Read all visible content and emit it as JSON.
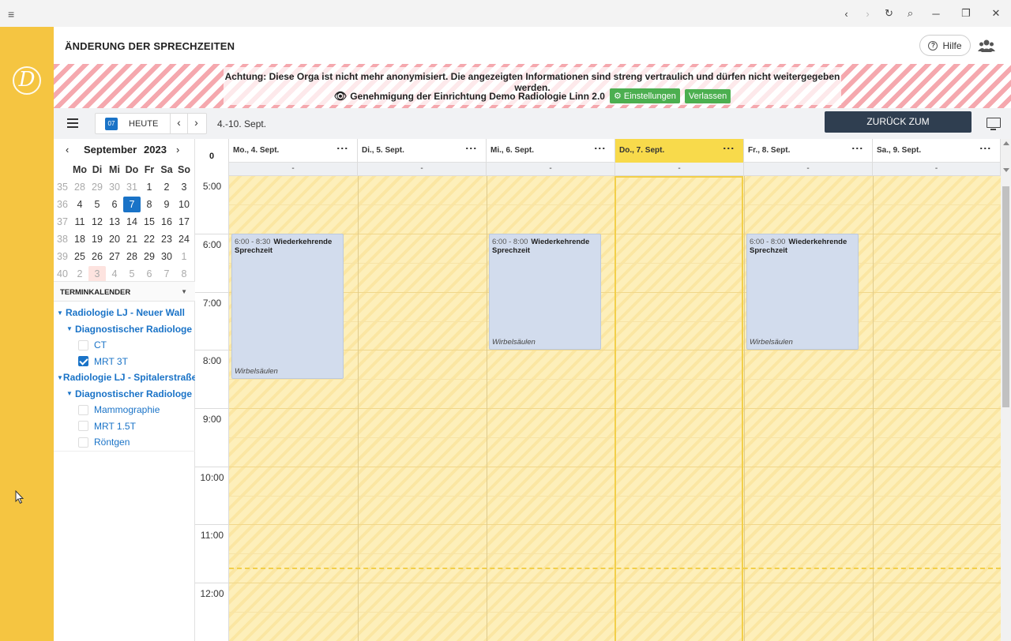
{
  "titlebar": {
    "menu_icon": "≡",
    "back": "‹",
    "forward": "›",
    "reload": "↻",
    "search": "⌕",
    "minimize": "─",
    "restore": "❐",
    "close": "✕"
  },
  "app": {
    "logo": "D"
  },
  "header": {
    "title": "ÄNDERUNG DER SPRECHZEITEN",
    "help_label": "Hilfe",
    "help_icon": "?"
  },
  "banner": {
    "warning": "Achtung: Diese Orga ist nicht mehr anonymisiert. Die angezeigten Informationen sind streng vertraulich und dürfen nicht weitergegeben werden.",
    "eye_icon": "👁",
    "approval": "Genehmigung der Einrichtung Demo Radiologie Linn 2.0",
    "settings_label": "⚙ Einstellungen",
    "leave_label": "Verlassen"
  },
  "toolbar": {
    "calendar_icon_day": "07",
    "today_label": "HEUTE",
    "prev": "‹",
    "next": "›",
    "range": "4.-10. Sept.",
    "back_label": "ZURÜCK ZUM TERMINKALENDER"
  },
  "mini": {
    "prev": "‹",
    "next": "›",
    "month": "September",
    "year": "2023",
    "headers": [
      "Mo",
      "Di",
      "Mi",
      "Do",
      "Fr",
      "Sa",
      "So"
    ],
    "weeks": [
      {
        "wk": "35",
        "days": [
          "28",
          "29",
          "30",
          "31",
          "1",
          "2",
          "3"
        ]
      },
      {
        "wk": "36",
        "days": [
          "4",
          "5",
          "6",
          "7",
          "8",
          "9",
          "10"
        ]
      },
      {
        "wk": "37",
        "days": [
          "11",
          "12",
          "13",
          "14",
          "15",
          "16",
          "17"
        ]
      },
      {
        "wk": "38",
        "days": [
          "18",
          "19",
          "20",
          "21",
          "22",
          "23",
          "24"
        ]
      },
      {
        "wk": "39",
        "days": [
          "25",
          "26",
          "27",
          "28",
          "29",
          "30",
          "1"
        ]
      },
      {
        "wk": "40",
        "days": [
          "2",
          "3",
          "4",
          "5",
          "6",
          "7",
          "8"
        ]
      }
    ]
  },
  "terminkalender": {
    "heading": "TERMINKALENDER",
    "toggle": "▼",
    "l1a": "Radiologie LJ - Neuer Wall",
    "l2a": "Diagnostischer Radiologe",
    "ct": "CT",
    "mrt3": "MRT 3T",
    "l1b": "Radiologie LJ - Spitalerstraße",
    "l2b": "Diagnostischer Radiologe",
    "mammo": "Mammographie",
    "mrt15": "MRT 1.5T",
    "roentgen": "Röntgen"
  },
  "calendar": {
    "week_label": "0",
    "days": [
      {
        "label": "Mo., 4. Sept.",
        "sub": "-"
      },
      {
        "label": "Di., 5. Sept.",
        "sub": "-"
      },
      {
        "label": "Mi., 6. Sept.",
        "sub": "-"
      },
      {
        "label": "Do., 7. Sept.",
        "sub": "-"
      },
      {
        "label": "Fr., 8. Sept.",
        "sub": "-"
      },
      {
        "label": "Sa., 9. Sept.",
        "sub": "-"
      }
    ],
    "menu_dots": "⋮",
    "times": [
      "5:00",
      "6:00",
      "7:00",
      "8:00",
      "9:00",
      "10:00",
      "11:00",
      "12:00"
    ],
    "events": [
      {
        "time": "6:00 - 8:30",
        "title": "Wiederkehrende Sprechzeit",
        "location": "Wirbelsäulen"
      },
      {
        "time": "6:00 - 8:00",
        "title": "Wiederkehrende Sprechzeit",
        "location": "Wirbelsäulen"
      },
      {
        "time": "6:00 - 8:00",
        "title": "Wiederkehrende Sprechzeit",
        "location": "Wirbelsäulen"
      }
    ]
  }
}
